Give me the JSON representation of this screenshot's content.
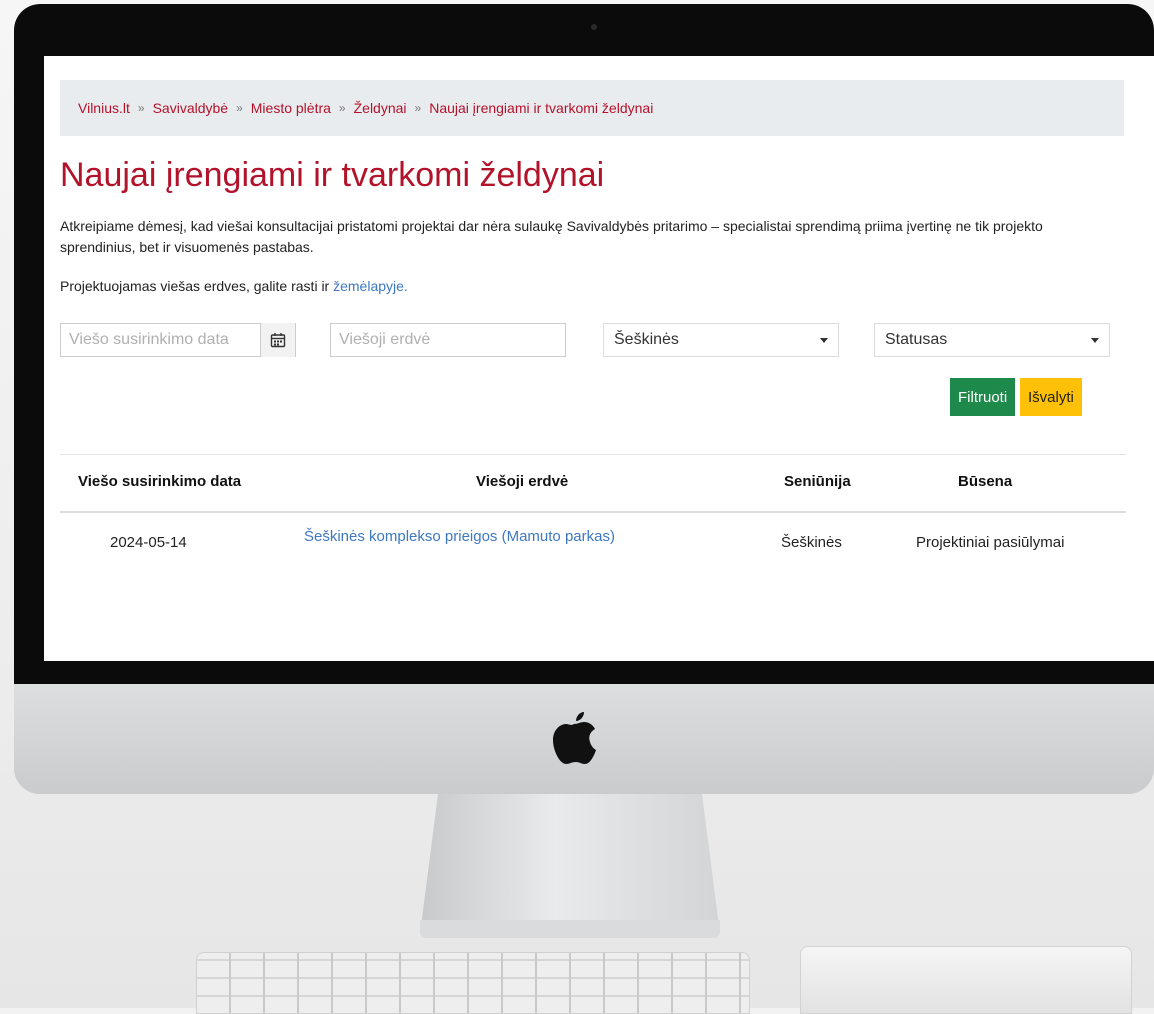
{
  "breadcrumb": {
    "items": [
      "Vilnius.lt",
      "Savivaldybė",
      "Miesto plėtra",
      "Želdynai",
      "Naujai įrengiami ir tvarkomi želdynai"
    ],
    "separator": "»"
  },
  "page": {
    "title": "Naujai įrengiami ir tvarkomi želdynai",
    "intro": "Atkreipiame dėmesį, kad viešai konsultacijai pristatomi projektai dar nėra sulaukę Savivaldybės pritarimo – specialistai sprendimą priima įvertinę ne tik projekto sprendinius, bet ir visuomenės pastabas.",
    "map_text": "Projektuojamas viešas erdves, galite rasti ir ",
    "map_link": "žemėlapyje."
  },
  "filters": {
    "date_placeholder": "Viešo susirinkimo data",
    "space_placeholder": "Viešoji erdvė",
    "district_value": "Šeškinės",
    "status_value": "Statusas",
    "filter_label": "Filtruoti",
    "clear_label": "Išvalyti"
  },
  "table": {
    "headers": [
      "Viešo susirinkimo data",
      "Viešoji erdvė",
      "Seniūnija",
      "Būsena"
    ],
    "rows": [
      {
        "date": "2024-05-14",
        "space": "Šeškinės komplekso prieigos (Mamuto parkas)",
        "district": "Šeškinės",
        "status": "Projektiniai pasiūlymai"
      }
    ]
  },
  "colors": {
    "brand_red": "#b3122b",
    "link_blue": "#3d78c2",
    "filter_green": "#1d8a4b",
    "clear_yellow": "#ffc107"
  },
  "icons": {
    "date": "calendar-icon",
    "select": "chevron-down-icon",
    "device": "apple-logo-icon"
  }
}
